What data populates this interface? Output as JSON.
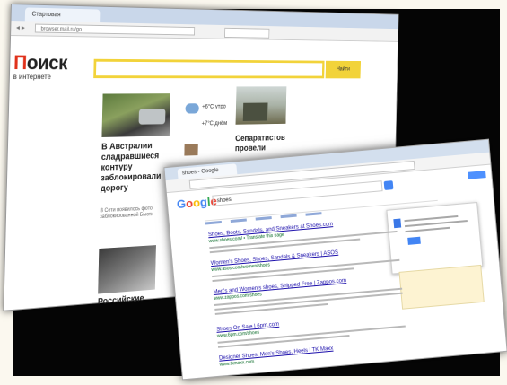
{
  "back_window": {
    "tab_title": "Стартовая",
    "url": "browser.mail.ru/go",
    "logo_main": "Поиск",
    "logo_sub": "в интернете",
    "search_button": "Найти",
    "news1_headline": "В Австралии сладравшиеся контуру заблокировали дорогу",
    "news1_text": "В Сети появилось фото заблокированной Бьюти",
    "weather1": "+6°C утро",
    "weather2": "+7°C днём",
    "news2_headline": "Сепаратистов провели",
    "news3_headline": "Российские"
  },
  "front_window": {
    "tab_title": "shoes - Google Search",
    "search_query": "shoes",
    "results": [
      {
        "title": "Shoes, Boots, Sandals, and Sneakers at Shoes.com",
        "url": "www.shoes.com/ • Translate this page"
      },
      {
        "title": "Women's Shoes, Shoes, Sandals & Sneakers | ASOS",
        "url": "www.asos.com/women/shoes"
      },
      {
        "title": "Men's and Women's shoes, Shipped Free | Zappos.com",
        "url": "www.zappos.com/shoes"
      },
      {
        "title": "Shoes On Sale | 6pm.com",
        "url": "www.6pm.com/shoes"
      },
      {
        "title": "Designer Shoes, Men's Shoes, Heels | TK Maxx",
        "url": "www.tkmaxx.com"
      }
    ]
  },
  "colors": {
    "yandex_yellow": "#f2d33a",
    "link_blue": "#1a0dab",
    "url_green": "#006621"
  }
}
